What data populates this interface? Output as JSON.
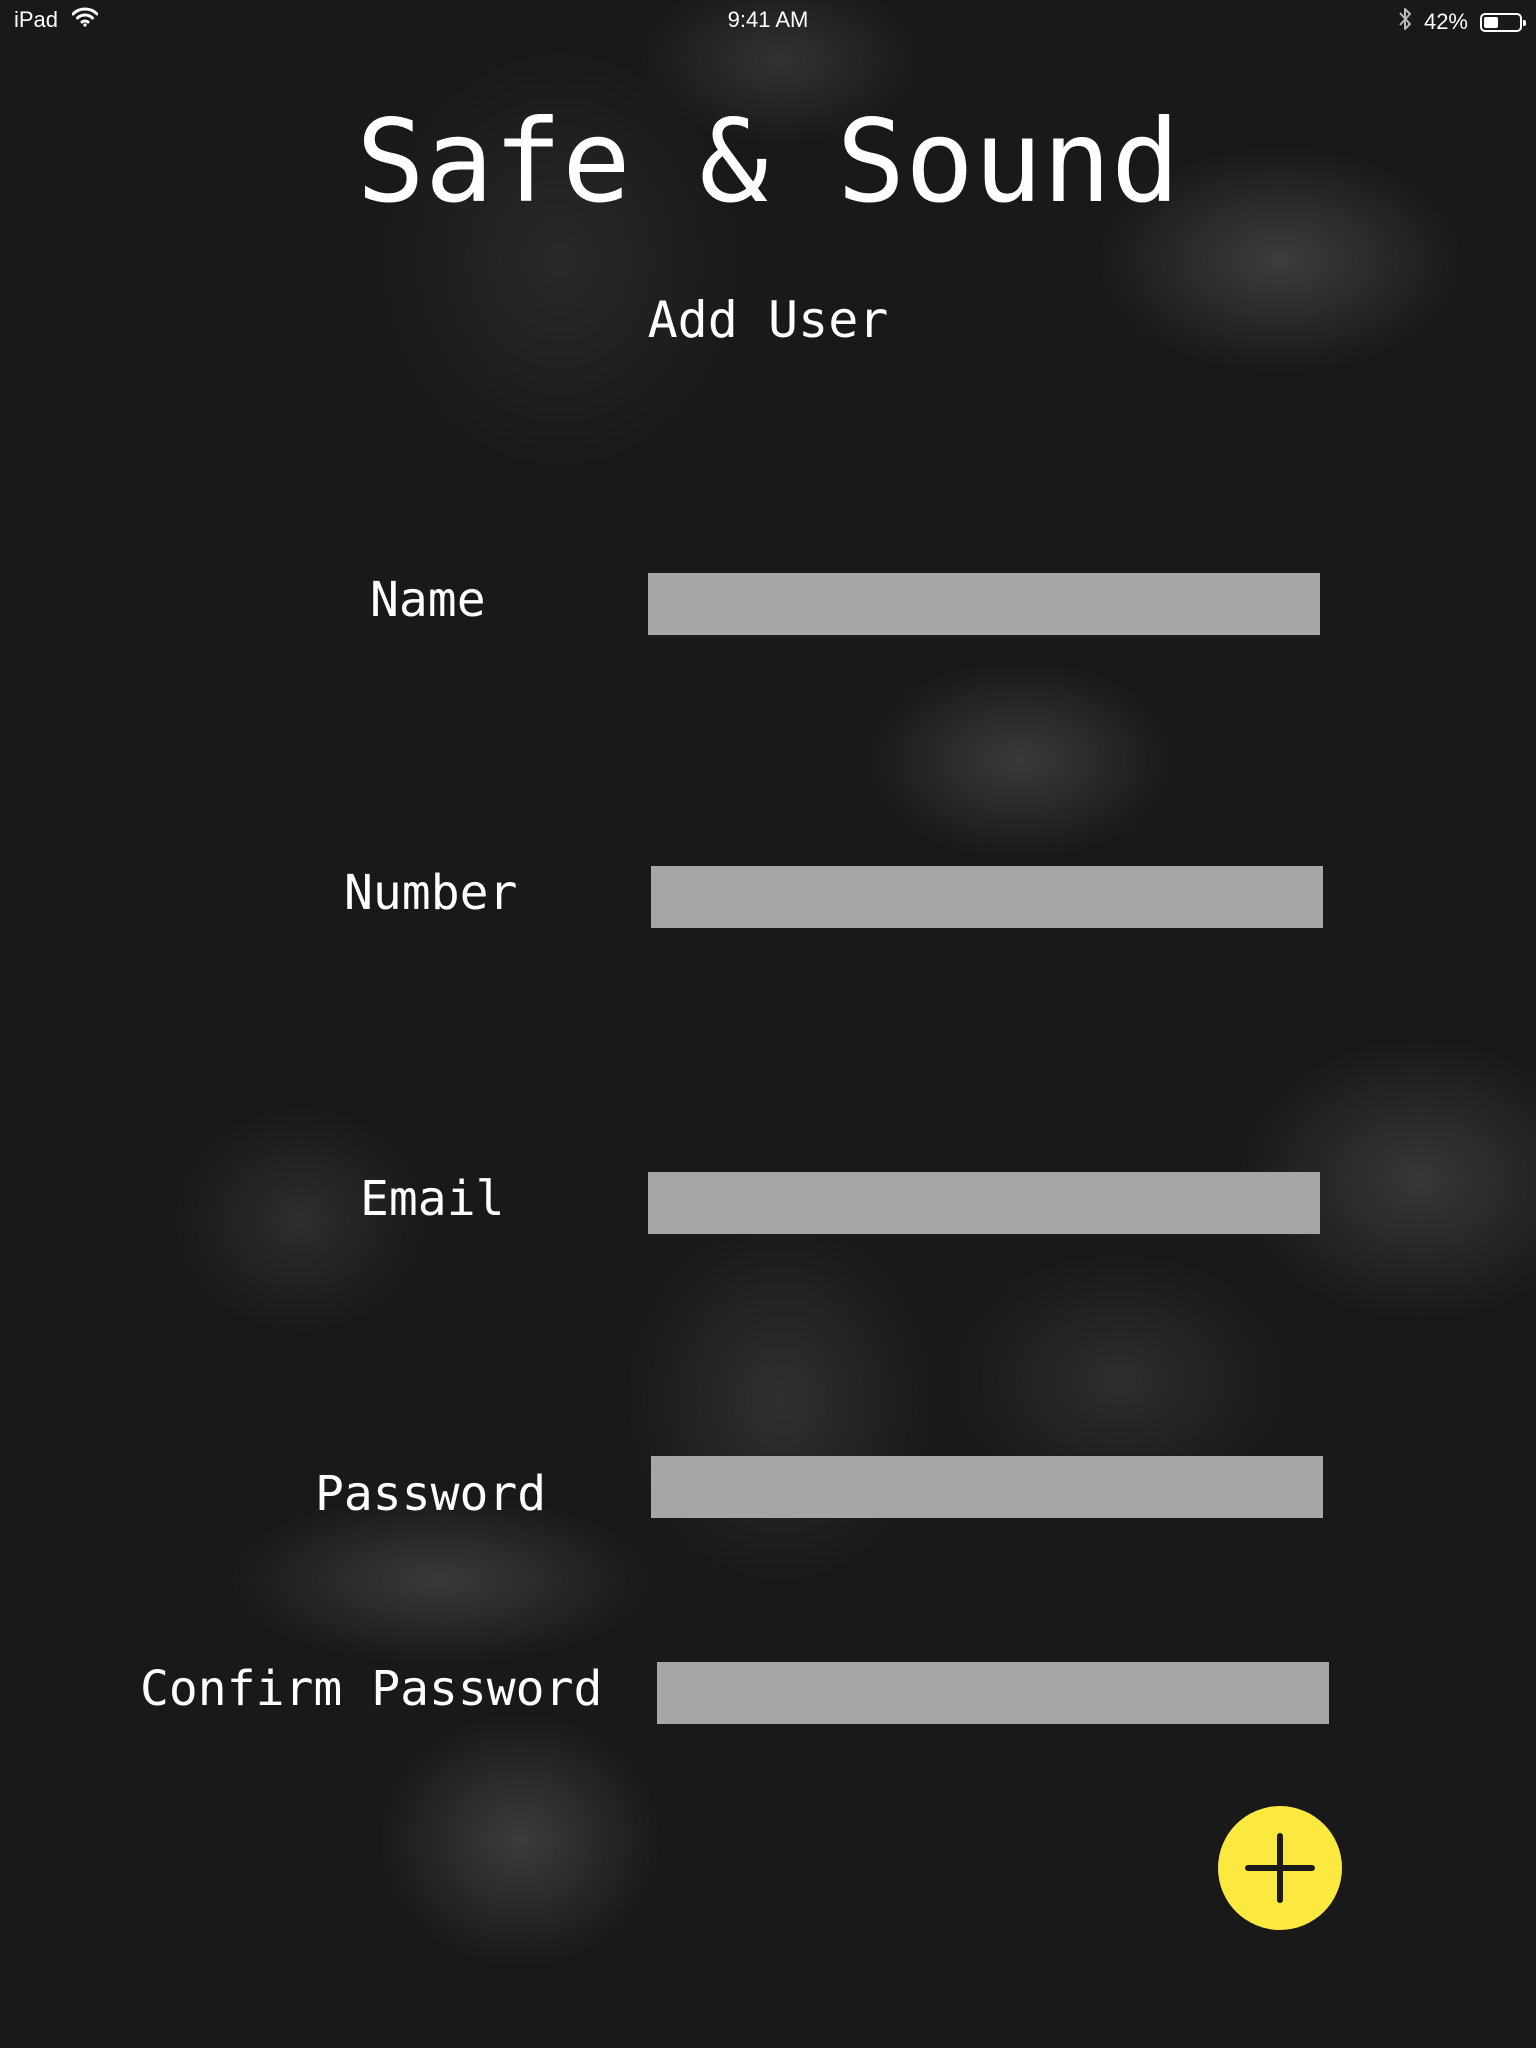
{
  "status_bar": {
    "device": "iPad",
    "time": "9:41 AM",
    "battery_text": "42%",
    "battery_level": 0.42,
    "wifi_icon": "wifi-icon",
    "bluetooth_icon": "bluetooth-icon"
  },
  "app": {
    "title": "Safe & Sound",
    "subtitle": "Add User"
  },
  "form": {
    "name_label": "Name",
    "name_value": "",
    "number_label": "Number",
    "number_value": "",
    "email_label": "Email",
    "email_value": "",
    "password_label": "Password",
    "password_value": "",
    "confirm_password_label": "Confirm Password",
    "confirm_password_value": ""
  },
  "add_button": {
    "icon": "plus-icon",
    "color": "#fce93f"
  },
  "colors": {
    "background": "#191919",
    "field_fill": "#a6a6a6",
    "text": "#ffffff",
    "accent": "#fce93f"
  }
}
